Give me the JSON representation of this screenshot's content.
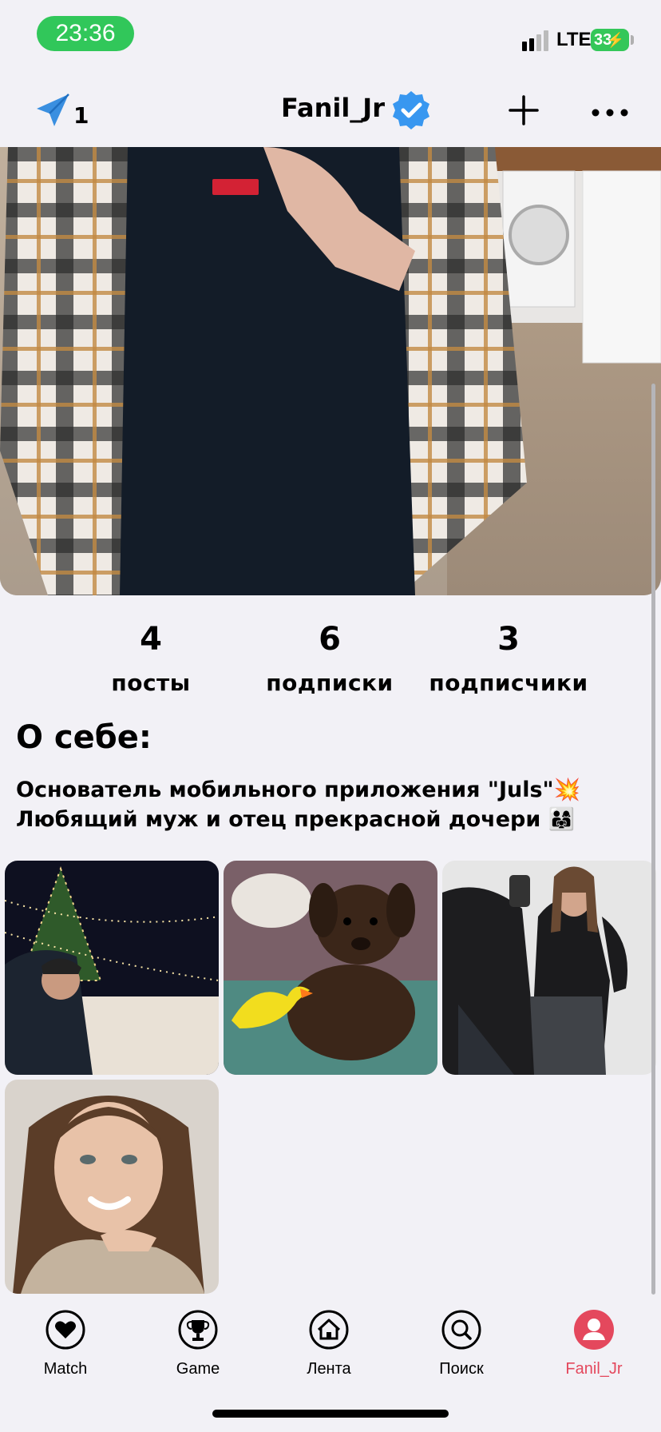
{
  "status": {
    "time": "23:36",
    "network": "LTE",
    "battery": "33"
  },
  "header": {
    "send_count": "1",
    "username": "Fanil_Jr"
  },
  "stats": [
    {
      "value": "4",
      "label": "посты"
    },
    {
      "value": "6",
      "label": "подписки"
    },
    {
      "value": "3",
      "label": "подписчики"
    }
  ],
  "about": {
    "title": "О себе:",
    "line1": "Основатель мобильного приложения \"Juls\"💥",
    "line2": "Любящий муж и отец прекрасной дочери 👨‍👩‍👧"
  },
  "tabs": [
    {
      "label": "Match",
      "icon": "heart-icon"
    },
    {
      "label": "Game",
      "icon": "trophy-icon"
    },
    {
      "label": "Лента",
      "icon": "home-icon"
    },
    {
      "label": "Поиск",
      "icon": "search-icon"
    },
    {
      "label": "Fanil_Jr",
      "icon": "profile-icon"
    }
  ],
  "colors": {
    "accent": "#e4485d",
    "verified": "#3897f0",
    "time_pill": "#31c75a"
  }
}
